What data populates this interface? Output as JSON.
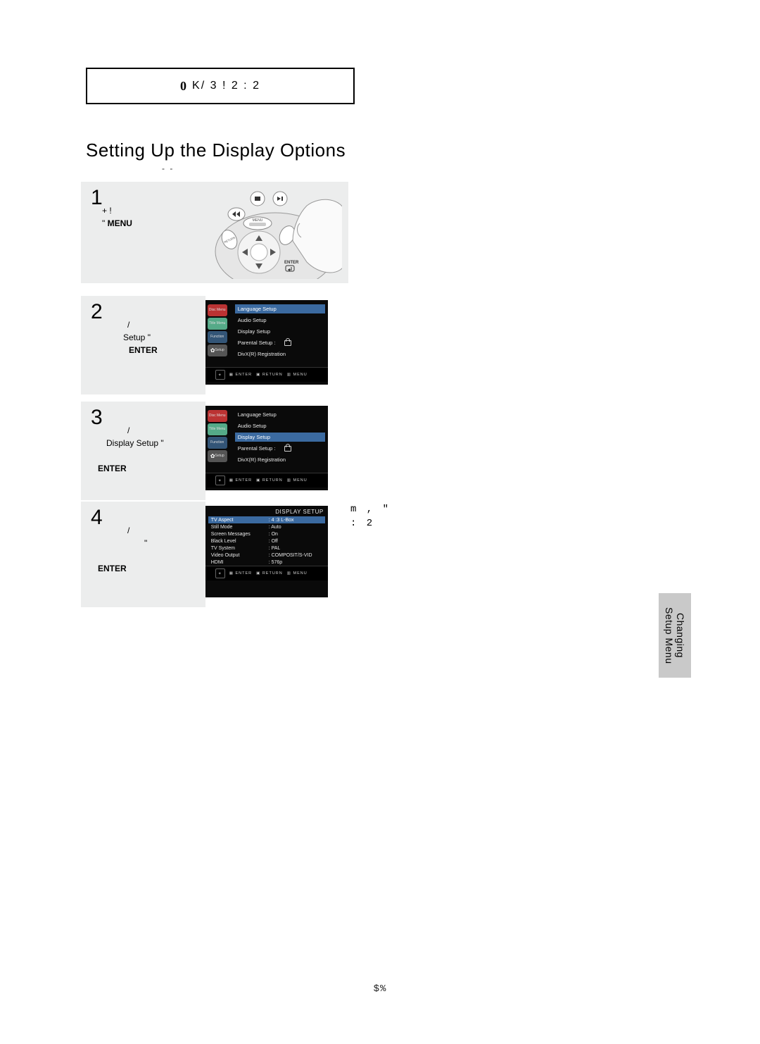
{
  "top_box": {
    "text": "K/  3      !    2   :   2"
  },
  "section": {
    "title": "Setting Up the Display Options",
    "subtitle": "-      -"
  },
  "step1": {
    "num": "1",
    "line1": "+            !",
    "line2_prefix": "\"             ",
    "line2_bold": "MENU"
  },
  "step2": {
    "num": "2",
    "line1": "/",
    "line2_prefix": "Setup",
    "line2_suffix": " \"",
    "line3_bold": "ENTER"
  },
  "step3": {
    "num": "3",
    "line1": "/",
    "line2_prefix": "Display Setup",
    "line2_suffix": "  \"",
    "line3_bold": "ENTER"
  },
  "step4": {
    "num": "4",
    "line1": "/",
    "line2": "\"",
    "line3_bold": "ENTER"
  },
  "setup_menu": {
    "side": [
      {
        "label": "Disc Menu",
        "cls": "red"
      },
      {
        "label": "Title Menu",
        "cls": "green"
      },
      {
        "label": "Function",
        "cls": "blue"
      },
      {
        "label": "Setup",
        "cls": "gray"
      }
    ],
    "items": [
      "Language Setup",
      "Audio Setup",
      "Display Setup",
      "Parental Setup :",
      "DivX(R) Registration"
    ],
    "footer": {
      "a": "ENTER",
      "b": "RETURN",
      "c": "MENU"
    }
  },
  "display_setup": {
    "title": "DISPLAY SETUP",
    "rows": [
      {
        "k": "TV Aspect",
        "v": "4 :3 L-Box",
        "hl": true
      },
      {
        "k": "Still Mode",
        "v": "Auto"
      },
      {
        "k": "Screen Messages",
        "v": "On"
      },
      {
        "k": "Black Level",
        "v": "Off"
      },
      {
        "k": "TV System",
        "v": "PAL"
      },
      {
        "k": "Video Output",
        "v": "COMPOSIT/S-VID"
      },
      {
        "k": "HDMI",
        "v": "576p"
      }
    ]
  },
  "annotation": {
    "row1": "m     ,                          \"",
    "row2": "    :  2"
  },
  "side_tab": {
    "line1": "Changing",
    "line2": "Setup Menu"
  },
  "page_number": "$%"
}
